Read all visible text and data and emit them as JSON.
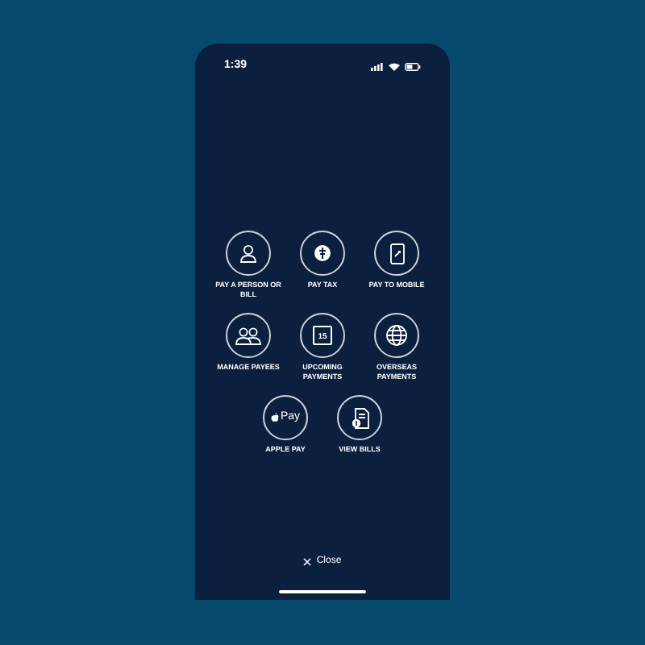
{
  "status_bar": {
    "time": "1:39"
  },
  "actions": [
    {
      "kind": "person",
      "label": "PAY A PERSON OR BILL"
    },
    {
      "kind": "tax",
      "label": "PAY TAX"
    },
    {
      "kind": "mobile",
      "label": "PAY TO MOBILE"
    },
    {
      "kind": "payees",
      "label": "MANAGE PAYEES"
    },
    {
      "kind": "calendar",
      "label": "UPCOMING PAYMENTS",
      "icon_text": "15"
    },
    {
      "kind": "globe",
      "label": "OVERSEAS PAYMENTS"
    },
    {
      "kind": "applepay",
      "label": "APPLE PAY",
      "icon_text": "Pay"
    },
    {
      "kind": "bills",
      "label": "VIEW BILLS"
    }
  ],
  "close": {
    "label": "Close"
  }
}
